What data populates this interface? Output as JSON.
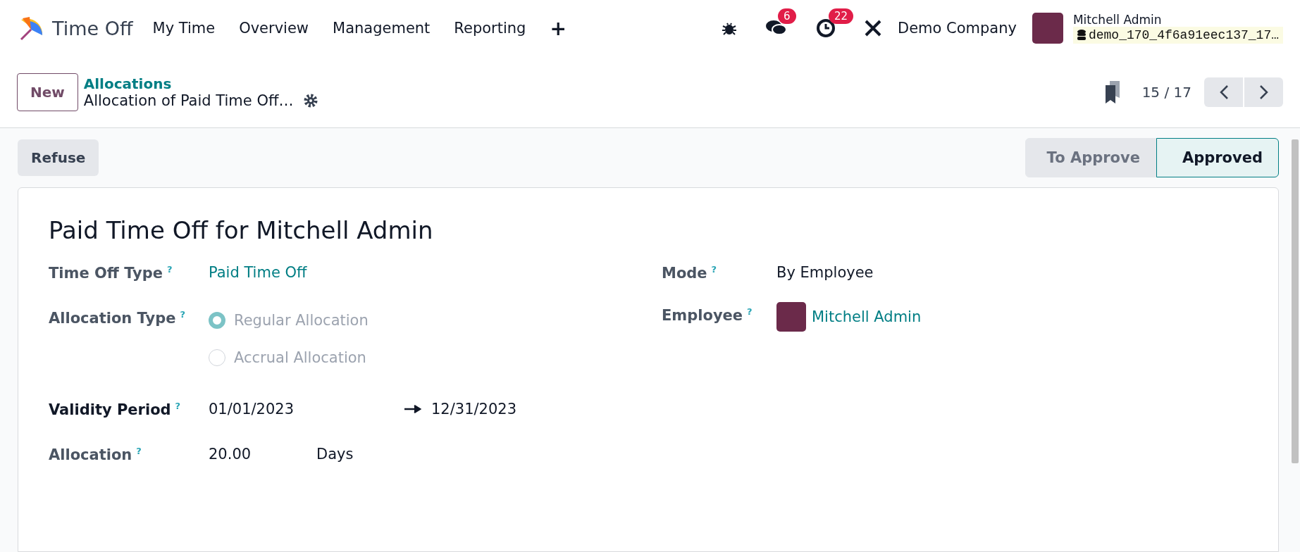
{
  "navbar": {
    "app_name": "Time Off",
    "menu": [
      {
        "label": "My Time"
      },
      {
        "label": "Overview"
      },
      {
        "label": "Management"
      },
      {
        "label": "Reporting"
      }
    ],
    "new_menu": "+",
    "messages_badge": "6",
    "activities_badge": "22",
    "company": "Demo Company",
    "user": {
      "name": "Mitchell Admin",
      "database": "demo_170_4f6a91eec137_17…"
    }
  },
  "control_panel": {
    "new_button": "New",
    "breadcrumb": "Allocations",
    "record_title": "Allocation of Paid Time Off…",
    "pager": "15 / 17"
  },
  "statusbar": {
    "buttons": [
      "Refuse"
    ],
    "stages": [
      {
        "label": "To Approve",
        "selected": false
      },
      {
        "label": "Approved",
        "selected": true
      }
    ]
  },
  "form": {
    "title": "Paid Time Off for Mitchell Admin",
    "time_off_type": {
      "label": "Time Off Type",
      "help": "?",
      "value": "Paid Time Off"
    },
    "allocation_type": {
      "label": "Allocation Type",
      "help": "?",
      "options": [
        {
          "label": "Regular Allocation",
          "selected": true
        },
        {
          "label": "Accrual Allocation",
          "selected": false
        }
      ]
    },
    "validity_period": {
      "label": "Validity Period",
      "help": "?",
      "start": "01/01/2023",
      "end": "12/31/2023"
    },
    "allocation": {
      "label": "Allocation",
      "help": "?",
      "value": "20.00",
      "unit": "Days"
    },
    "mode": {
      "label": "Mode",
      "help": "?",
      "value": "By Employee"
    },
    "employee": {
      "label": "Employee",
      "help": "?",
      "value": "Mitchell Admin"
    }
  }
}
